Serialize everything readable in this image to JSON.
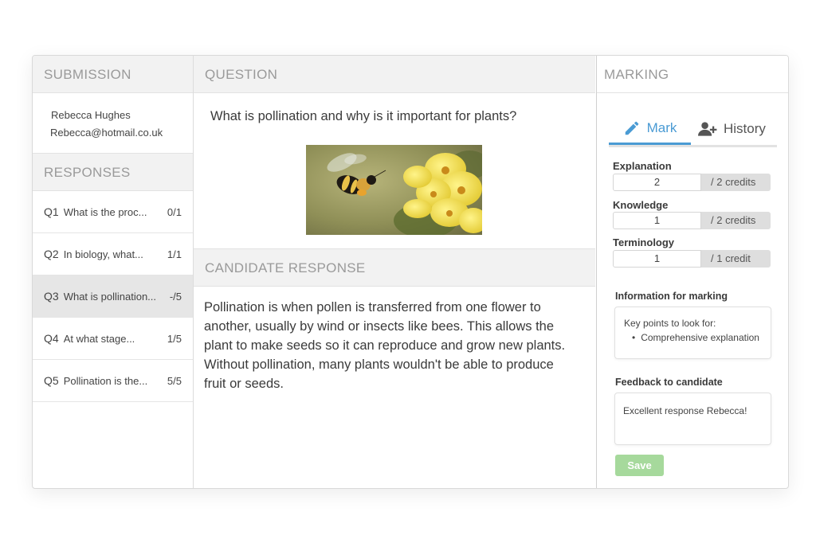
{
  "submission": {
    "heading": "SUBMISSION",
    "name": "Rebecca Hughes",
    "email": "Rebecca@hotmail.co.uk"
  },
  "responses": {
    "heading": "RESPONSES",
    "items": [
      {
        "q": "Q1",
        "text": "What is the proc...",
        "score": "0/1",
        "active": false
      },
      {
        "q": "Q2",
        "text": "In biology, what...",
        "score": "1/1",
        "active": false
      },
      {
        "q": "Q3",
        "text": "What is pollination...",
        "score": "-/5",
        "active": true
      },
      {
        "q": "Q4",
        "text": "At what stage...",
        "score": "1/5",
        "active": false
      },
      {
        "q": "Q5",
        "text": "Pollination is the...",
        "score": "5/5",
        "active": false
      }
    ]
  },
  "question": {
    "heading": "QUESTION",
    "text": "What is pollination and why is it important for plants?"
  },
  "candidate": {
    "heading": "CANDIDATE RESPONSE",
    "answer": "Pollination is when pollen is transferred from one flower to another, usually by wind or insects like bees. This allows the plant to make seeds so it can reproduce and grow new plants. Without pollination, many plants wouldn't be able to produce fruit or seeds."
  },
  "marking": {
    "heading": "MARKING",
    "tabs": {
      "mark": "Mark",
      "history": "History"
    },
    "criteria": [
      {
        "label": "Explanation",
        "value": "2",
        "unit": "/ 2 credits"
      },
      {
        "label": "Knowledge",
        "value": "1",
        "unit": "/ 2 credits"
      },
      {
        "label": "Terminology",
        "value": "1",
        "unit": "/  1 credit"
      }
    ],
    "info_label": "Information for marking",
    "info_intro": "Key points to look for:",
    "info_bullet": "Comprehensive explanation",
    "feedback_label": "Feedback to candidate",
    "feedback_text": "Excellent response Rebecca!",
    "save_label": "Save"
  },
  "colors": {
    "accent": "#4a9bd4",
    "save": "#a6d99c",
    "active_row": "#e6e6e6"
  }
}
